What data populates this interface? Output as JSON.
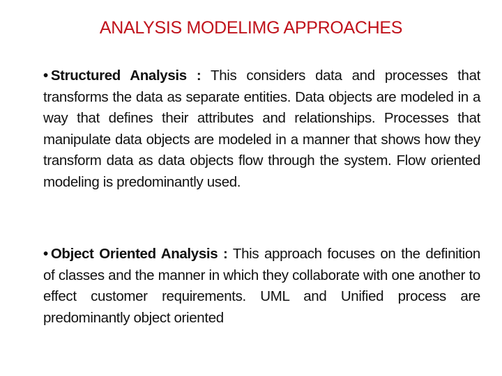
{
  "slide": {
    "title": "ANALYSIS MODELIMG APPROACHES",
    "title_color": "#c0121b",
    "bullets": [
      {
        "marker": "•",
        "term": "Structured Analysis :",
        "text": " This considers data and processes that transforms the data as separate entities. Data objects are modeled in a way that defines their attributes and relationships. Processes that manipulate data objects are modeled in a manner that shows how they transform data as data objects flow through the system. Flow oriented modeling is predominantly used."
      },
      {
        "marker": "•",
        "term": "Object Oriented Analysis :",
        "text": "  This approach focuses on the definition of classes and the manner in which they collaborate with one another to effect customer requirements. UML and Unified process are predominantly object oriented"
      }
    ]
  }
}
